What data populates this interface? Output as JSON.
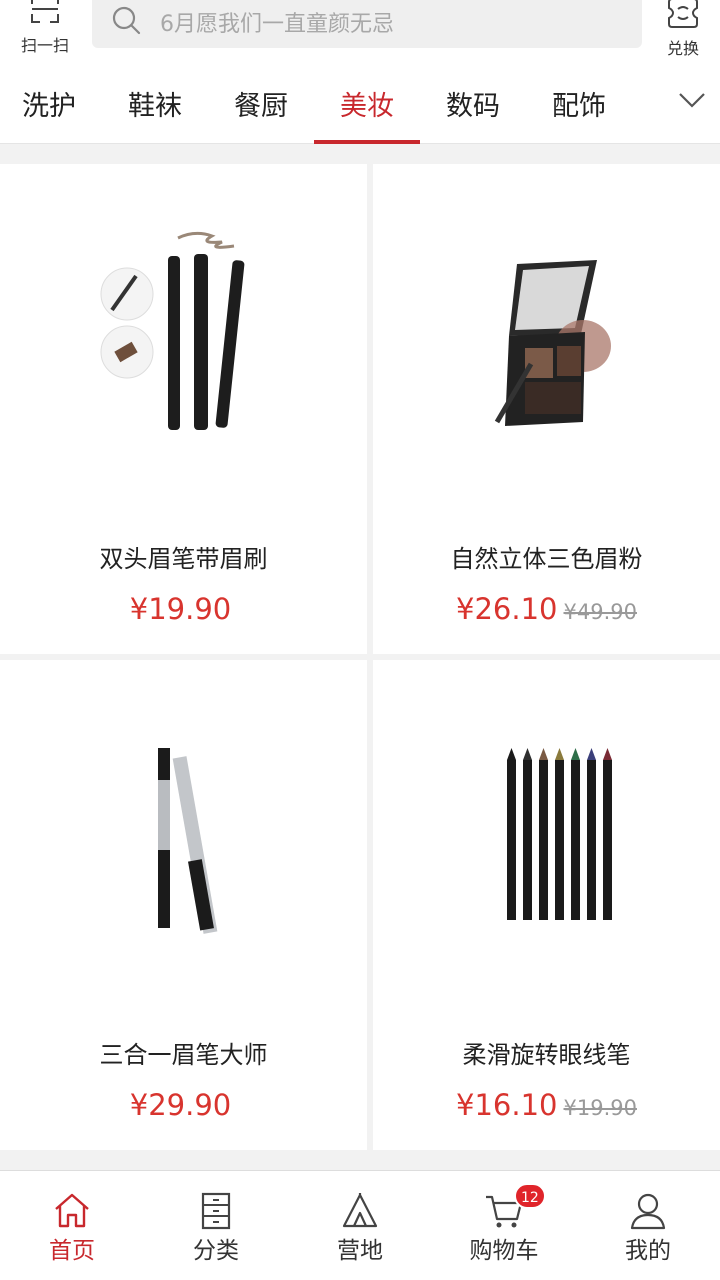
{
  "header": {
    "scan_label": "扫一扫",
    "search_placeholder": "6月愿我们一直童颜无忌",
    "exchange_label": "兑换"
  },
  "tabs": [
    {
      "label": "洗护"
    },
    {
      "label": "鞋袜"
    },
    {
      "label": "餐厨"
    },
    {
      "label": "美妆",
      "active": true
    },
    {
      "label": "数码"
    },
    {
      "label": "配饰"
    }
  ],
  "products": [
    {
      "name": "双头眉笔带眉刷",
      "price": "¥19.90",
      "original_price": ""
    },
    {
      "name": "自然立体三色眉粉",
      "price": "¥26.10",
      "original_price": "¥49.90"
    },
    {
      "name": "三合一眉笔大师",
      "price": "¥29.90",
      "original_price": ""
    },
    {
      "name": "柔滑旋转眼线笔",
      "price": "¥16.10",
      "original_price": "¥19.90"
    }
  ],
  "bottom_nav": [
    {
      "label": "首页",
      "icon": "home-icon",
      "active": true
    },
    {
      "label": "分类",
      "icon": "category-icon"
    },
    {
      "label": "营地",
      "icon": "tent-icon"
    },
    {
      "label": "购物车",
      "icon": "cart-icon",
      "badge": "12"
    },
    {
      "label": "我的",
      "icon": "user-icon"
    }
  ],
  "colors": {
    "accent": "#c8282d",
    "price": "#d8342e",
    "badge": "#e0242a"
  }
}
